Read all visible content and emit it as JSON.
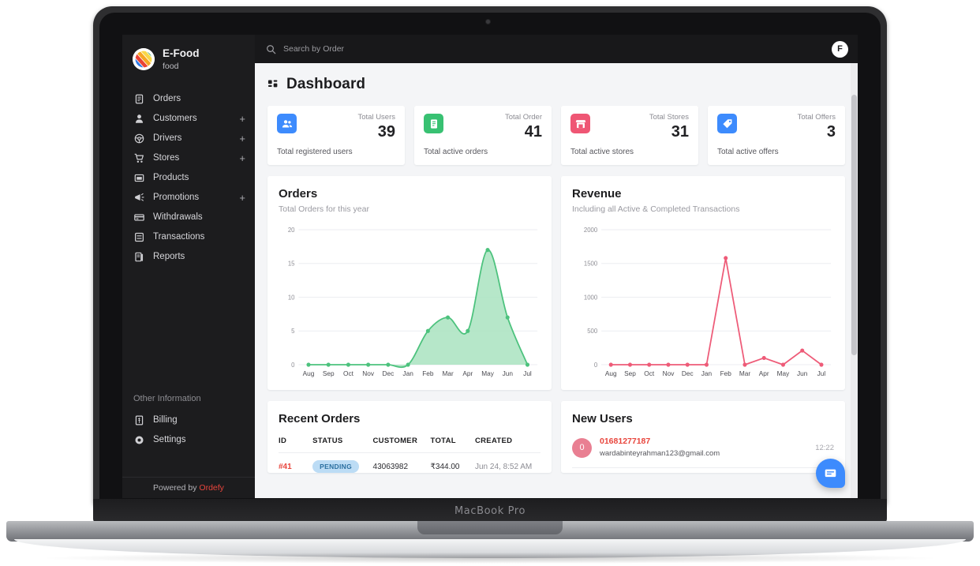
{
  "device": {
    "model_label": "MacBook Pro"
  },
  "sidebar": {
    "brand": {
      "name": "E-Food",
      "sub": "food"
    },
    "items": [
      {
        "label": "Orders",
        "icon": "clipboard-icon",
        "expandable": false
      },
      {
        "label": "Customers",
        "icon": "user-icon",
        "expandable": true,
        "plus": "+"
      },
      {
        "label": "Drivers",
        "icon": "steering-icon",
        "expandable": true,
        "plus": "+"
      },
      {
        "label": "Stores",
        "icon": "cart-icon",
        "expandable": true,
        "plus": "+"
      },
      {
        "label": "Products",
        "icon": "box-icon",
        "expandable": false
      },
      {
        "label": "Promotions",
        "icon": "megaphone-icon",
        "expandable": true,
        "plus": "+"
      },
      {
        "label": "Withdrawals",
        "icon": "card-icon",
        "expandable": false
      },
      {
        "label": "Transactions",
        "icon": "exchange-icon",
        "expandable": false
      },
      {
        "label": "Reports",
        "icon": "report-icon",
        "expandable": false
      }
    ],
    "other_section_title": "Other Information",
    "other_items": [
      {
        "label": "Billing",
        "icon": "receipt-icon"
      },
      {
        "label": "Settings",
        "icon": "gear-icon"
      }
    ],
    "footer": {
      "prefix": "Powered by ",
      "brand": "Ordefy"
    }
  },
  "topbar": {
    "search_placeholder": "Search by Order",
    "search_value": "",
    "avatar_initial": "F"
  },
  "page": {
    "title": "Dashboard"
  },
  "stats": [
    {
      "label": "Total Users",
      "value": "39",
      "desc": "Total registered users",
      "icon": "users-icon",
      "color": "#3d8bfd"
    },
    {
      "label": "Total Order",
      "value": "41",
      "desc": "Total active orders",
      "icon": "order-icon",
      "color": "#38c172"
    },
    {
      "label": "Total Stores",
      "value": "31",
      "desc": "Total active stores",
      "icon": "store-icon",
      "color": "#ef5674"
    },
    {
      "label": "Total Offers",
      "value": "3",
      "desc": "Total active offers",
      "icon": "tag-icon",
      "color": "#3d8bfd"
    }
  ],
  "chart_data": [
    {
      "type": "area",
      "title": "Orders",
      "subtitle": "Total Orders for this year",
      "categories": [
        "Aug",
        "Sep",
        "Oct",
        "Nov",
        "Dec",
        "Jan",
        "Feb",
        "Mar",
        "Apr",
        "May",
        "Jun",
        "Jul"
      ],
      "values": [
        0,
        0,
        0,
        0,
        0,
        0,
        5,
        7,
        5,
        17,
        7,
        0
      ],
      "yticks": [
        0,
        5,
        10,
        15,
        20
      ],
      "ylim": [
        0,
        20
      ],
      "xlabel": "",
      "ylabel": "",
      "grid": true,
      "legend": "none",
      "line_color": "#4cc27d",
      "fill_color": "#a9e3bf"
    },
    {
      "type": "line",
      "title": "Revenue",
      "subtitle": "Including all Active & Completed Transactions",
      "categories": [
        "Aug",
        "Sep",
        "Oct",
        "Nov",
        "Dec",
        "Jan",
        "Feb",
        "Mar",
        "Apr",
        "May",
        "Jun",
        "Jul"
      ],
      "values": [
        0,
        0,
        0,
        0,
        0,
        0,
        1580,
        0,
        100,
        0,
        210,
        0
      ],
      "yticks": [
        0,
        500,
        1000,
        1500,
        2000
      ],
      "ylim": [
        0,
        2000
      ],
      "xlabel": "",
      "ylabel": "",
      "grid": true,
      "legend": "none",
      "line_color": "#ee5b78"
    }
  ],
  "recent_orders": {
    "title": "Recent Orders",
    "columns": [
      "ID",
      "STATUS",
      "CUSTOMER",
      "TOTAL",
      "CREATED"
    ],
    "rows": [
      {
        "id": "#41",
        "status": "PENDING",
        "customer": "43063982",
        "total": "₹344.00",
        "created": "Jun 24, 8:52 AM"
      }
    ]
  },
  "new_users": {
    "title": "New Users",
    "rows": [
      {
        "initial": "0",
        "phone": "01681277187",
        "email": "wardabinteyrahman123@gmail.com",
        "time": "12:22"
      }
    ]
  },
  "chat": {
    "icon": "chat-bubble-icon"
  }
}
